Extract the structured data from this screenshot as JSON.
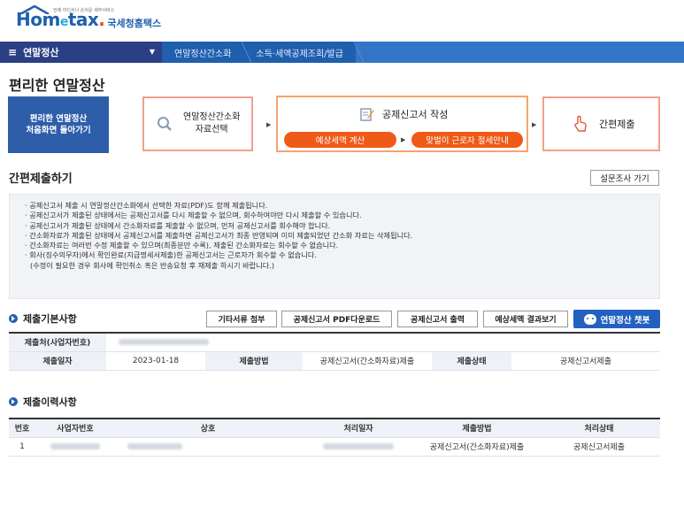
{
  "header": {
    "logo_brand_pre": "Hom",
    "logo_brand_e": "e",
    "logo_brand_post": "tax",
    "logo_dot": ".",
    "logo_sub": "국세청홈택스",
    "logo_tiny": "언제 어디서나 손쉬운 세무서비스"
  },
  "nav": {
    "menu_icon": "≡",
    "home_label": "연말정산",
    "caret": "▼",
    "items": [
      "연말정산간소화",
      "소득·세액공제조회/발급"
    ]
  },
  "page_title": "편리한 연말정산",
  "steps": {
    "start_button": "편리한 연말정산\n처음화면 돌아가기",
    "step1_label": "연말정산간소화\n자료선택",
    "step2_title": "공제신고서 작성",
    "step2_pill1": "예상세액 계산",
    "step2_pill2": "맞벌이 근로자 절세안내",
    "step3_label": "간편제출",
    "arrow": "▶"
  },
  "section_title": "간편제출하기",
  "survey_button": "설문조사 가기",
  "notices": [
    "공제신고서 제출 시 연말정산간소화에서 선택한 자료(PDF)도 함께 제출됩니다.",
    "공제신고서가 제출된 상태에서는 공제신고서를 다시 제출할 수 없으며, 회수하여야만 다시 제출할 수 있습니다.",
    "공제신고서가 제출된 상태에서 간소화자료를 제출할 수 없으며, 먼저 공제신고서를 회수해야 합니다.",
    "간소화자료가 제출된 상태에서 공제신고서를 제출하면 공제신고서가 최종 반영되며 이미 제출되었던 간소화 자료는 삭제됩니다.",
    "간소화자료는 여러번 수정 제출할 수 있으며(최종분만 수록), 제출된 간소화자료는 회수할 수 없습니다.",
    "회사(징수의무자)에서 확인완료(지급명세서제출)한 공제신고서는 근로자가 회수할 수 없습니다.",
    "(수정이 필요한 경우 회사에 확인취소 혹은 반송요청 후 재제출 하시기 바랍니다.)"
  ],
  "basic": {
    "title": "제출기본사항",
    "buttons": [
      "기타서류 첨부",
      "공제신고서 PDF다운로드",
      "공제신고서 출력",
      "예상세액 결과보기"
    ],
    "chatbot_button": "연말정산 챗봇",
    "row1_label": "제출처(사업자번호)",
    "row2_labels": [
      "제출일자",
      "제출방법",
      "제출상태"
    ],
    "submit_date": "2023-01-18",
    "submit_method": "공제신고서(간소화자료)제출",
    "submit_status": "공제신고서제출"
  },
  "history": {
    "title": "제출이력사항",
    "columns": [
      "번호",
      "사업자번호",
      "상호",
      "처리일자",
      "제출방법",
      "처리상태"
    ],
    "rows": [
      {
        "no": "1",
        "method": "공제신고서(간소화자료)제출",
        "status": "공제신고서제출"
      }
    ]
  },
  "colors": {
    "nav_bg": "#1f5fae",
    "nav_home_bg": "#2b3f86",
    "accent_orange": "#ef5a18",
    "start_btn_bg": "#2e5ea9",
    "chatbot_bg": "#2361c0"
  }
}
